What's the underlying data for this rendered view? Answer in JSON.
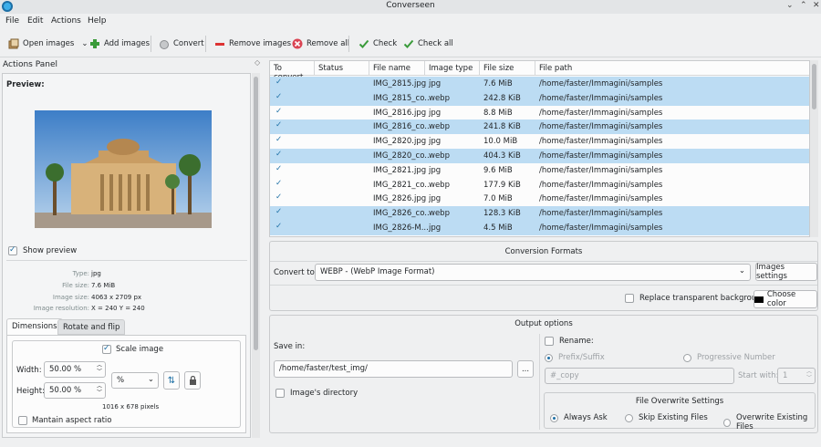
{
  "window": {
    "title": "Converseen",
    "controls": [
      "⌄",
      "⌃",
      "✕"
    ]
  },
  "menu": [
    "File",
    "Edit",
    "Actions",
    "Help"
  ],
  "toolbar": {
    "open_images": "Open images",
    "add_images": "Add images",
    "convert": "Convert",
    "remove_images": "Remove images",
    "remove_all": "Remove all",
    "check": "Check",
    "check_all": "Check all"
  },
  "actions_panel": {
    "title": "Actions Panel",
    "preview_label": "Preview:",
    "show_preview": "Show preview",
    "info": {
      "type_label": "Type:",
      "type": "jpg",
      "size_label": "File size:",
      "size": "7.6 MiB",
      "dim_label": "Image size:",
      "dim": "4063 x 2709 px",
      "res_label": "Image resolution:",
      "res": "X = 240 Y = 240"
    },
    "tabs": [
      "Dimensions",
      "Rotate and flip"
    ],
    "scale_image": "Scale image",
    "width_label": "Width:",
    "width_value": "50.00 %",
    "height_label": "Height:",
    "height_value": "50.00 %",
    "unit": "%",
    "result_size": "1016 x 678 pixels",
    "maintain_aspect": "Mantain aspect ratio"
  },
  "table": {
    "columns": [
      "To convert",
      "Status",
      "File name",
      "Image type",
      "File size",
      "File path"
    ],
    "rows": [
      {
        "name": "IMG_2815.jpg",
        "type": "jpg",
        "size": "7.6 MiB",
        "path": "/home/faster/Immagini/samples",
        "selected": true
      },
      {
        "name": "IMG_2815_co...",
        "type": "webp",
        "size": "242.8 KiB",
        "path": "/home/faster/Immagini/samples",
        "selected": true
      },
      {
        "name": "IMG_2816.jpg",
        "type": "jpg",
        "size": "8.8 MiB",
        "path": "/home/faster/Immagini/samples",
        "selected": false
      },
      {
        "name": "IMG_2816_co...",
        "type": "webp",
        "size": "241.8 KiB",
        "path": "/home/faster/Immagini/samples",
        "selected": true
      },
      {
        "name": "IMG_2820.jpg",
        "type": "jpg",
        "size": "10.0 MiB",
        "path": "/home/faster/Immagini/samples",
        "selected": false
      },
      {
        "name": "IMG_2820_co...",
        "type": "webp",
        "size": "404.3 KiB",
        "path": "/home/faster/Immagini/samples",
        "selected": true
      },
      {
        "name": "IMG_2821.jpg",
        "type": "jpg",
        "size": "9.6 MiB",
        "path": "/home/faster/Immagini/samples",
        "selected": false
      },
      {
        "name": "IMG_2821_co...",
        "type": "webp",
        "size": "177.9 KiB",
        "path": "/home/faster/Immagini/samples",
        "selected": false
      },
      {
        "name": "IMG_2826.jpg",
        "type": "jpg",
        "size": "7.0 MiB",
        "path": "/home/faster/Immagini/samples",
        "selected": false
      },
      {
        "name": "IMG_2826_co...",
        "type": "webp",
        "size": "128.3 KiB",
        "path": "/home/faster/Immagini/samples",
        "selected": true
      },
      {
        "name": "IMG_2826-M...",
        "type": "jpg",
        "size": "4.5 MiB",
        "path": "/home/faster/Immagini/samples",
        "selected": true
      }
    ]
  },
  "conversion": {
    "title": "Conversion Formats",
    "convert_to_label": "Convert to:",
    "format": "WEBP - (WebP Image Format)",
    "images_settings": "Images settings",
    "replace_transparent": "Replace transparent background",
    "choose_color": "Choose color"
  },
  "output": {
    "title": "Output options",
    "save_in": "Save in:",
    "path": "/home/faster/test_img/",
    "browse": "...",
    "image_dir": "Image's directory",
    "rename": "Rename:",
    "prefix_suffix": "Prefix/Suffix",
    "progressive": "Progressive Number",
    "placeholder": "#_copy",
    "start_with": "Start with:",
    "start_value": "1",
    "overwrite_title": "File Overwrite Settings",
    "always_ask": "Always Ask",
    "skip_existing": "Skip Existing Files",
    "overwrite_existing": "Overwrite Existing Files"
  }
}
